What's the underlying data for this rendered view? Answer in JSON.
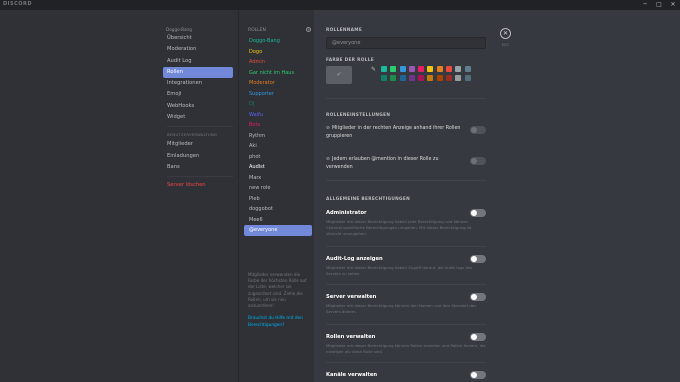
{
  "window": {
    "title": "DISCORD",
    "minimize": "─",
    "maximize": "□",
    "close": "✕"
  },
  "nav": {
    "server_name": "Doggo-Bang",
    "items": [
      "Übersicht",
      "Moderation",
      "Audit Log",
      "Rollen",
      "Integrationen",
      "Emoji",
      "WebHooks",
      "Widget"
    ],
    "active": "Rollen",
    "category": "BENUTZERVERWALTUNG",
    "user_items": [
      "Mitglieder",
      "Einladungen",
      "Bans"
    ],
    "delete": "Server löschen"
  },
  "roles": {
    "header": "ROLLEN",
    "add": "+",
    "list": [
      {
        "name": "Doggo-Bang",
        "color": "#1abc9c"
      },
      {
        "name": "Dogo",
        "color": "#f1c40f"
      },
      {
        "name": "Admin",
        "color": "#e74c3c"
      },
      {
        "name": "Gar nicht im Haus",
        "color": "#2ecc71"
      },
      {
        "name": "Moderator",
        "color": "#e67e22"
      },
      {
        "name": "Supporter",
        "color": "#3498db"
      },
      {
        "name": "DJ",
        "color": "#11806a"
      },
      {
        "name": "Waifu",
        "color": "#5865f2"
      },
      {
        "name": "Bots",
        "color": "#e91e63"
      },
      {
        "name": "Rythm",
        "color": "#b9bbbe"
      },
      {
        "name": "Aki",
        "color": "#b9bbbe"
      },
      {
        "name": "phot",
        "color": "#b9bbbe"
      },
      {
        "name": "Audist",
        "color": "#ffffff"
      },
      {
        "name": "Marx",
        "color": "#b9bbbe"
      },
      {
        "name": "new role",
        "color": "#b9bbbe"
      },
      {
        "name": "Pleb",
        "color": "#b9bbbe"
      },
      {
        "name": "doggobot",
        "color": "#b9bbbe"
      },
      {
        "name": "Mee6",
        "color": "#b9bbbe"
      },
      {
        "name": "@everyone",
        "color": "#ffffff"
      }
    ],
    "selected": "@everyone",
    "help_text": "Mitglieder verwenden die Farbe der höchsten Rolle auf der Liste, welcher sie zugeordnet sind. Ziehe die Rollen, um sie neu anzuordnen!",
    "help_link": "Brauchst du Hilfe mit den Berechtigungen?"
  },
  "main": {
    "role_name_label": "ROLLENNAME",
    "role_name_value": "@everyone",
    "esc_icon": "✕",
    "esc_label": "ESC",
    "color_label": "FARBE DER ROLLE",
    "default_check": "✓",
    "picker_icon": "✎",
    "swatches": [
      "#1abc9c",
      "#2ecc71",
      "#3498db",
      "#9b59b6",
      "#e91e63",
      "#f1c40f",
      "#e67e22",
      "#e74c3c",
      "#95a5a6",
      "#607d8b",
      "#11806a",
      "#1f8b4c",
      "#206694",
      "#71368a",
      "#ad1457",
      "#c27c0e",
      "#a84300",
      "#992d22",
      "#979c9f",
      "#546e7a"
    ],
    "settings_label": "ROLLENEINSTELLUNGEN",
    "settings": [
      "Mitglieder in der rechten Anzeige anhand ihrer Rollen gruppieren",
      "Jedem erlauben @mention in dieser Rolle zu verwenden"
    ],
    "general_label": "ALLGEMEINE BERECHTIGUNGEN",
    "perms": [
      {
        "title": "Administrator",
        "desc": "Mitglieder mit dieser Berechtigung haben jede Berechtigung und können Channel-spezifische Berechtigungen umgehen. Mit dieser Berechtigung ist Vorsicht umzugehen."
      },
      {
        "title": "Audit-Log anzeigen",
        "desc": "Mitglieder mit dieser Berechtigung haben Zugriff darauf, die Audit-logs des Servers zu sehen."
      },
      {
        "title": "Server verwalten",
        "desc": "Mitglieder mit dieser Berechtigung können den Namen und den Standort des Servers ändern."
      },
      {
        "title": "Rollen verwalten",
        "desc": "Mitglieder mit dieser Berechtigung können Rollen erstellen und Rollen ändern, die niedriger als diese Rolle sind."
      },
      {
        "title": "Kanäle verwalten",
        "desc": ""
      }
    ]
  }
}
